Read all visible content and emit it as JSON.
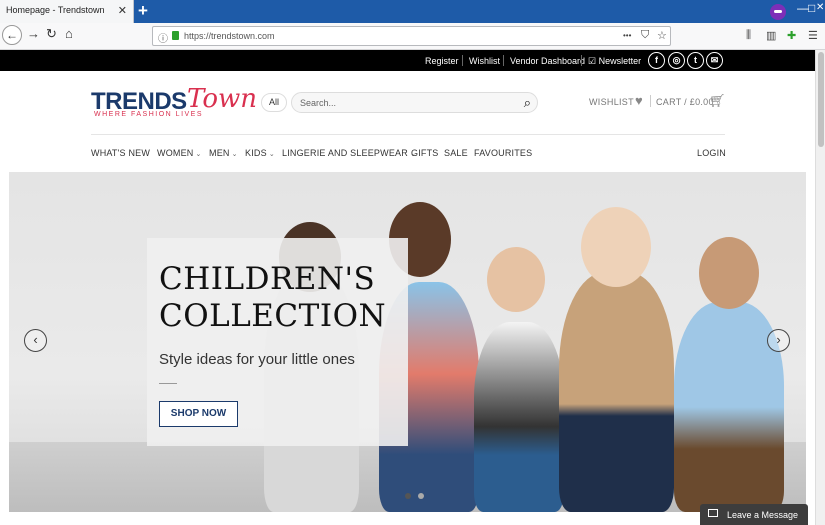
{
  "browser": {
    "tab_title": "Homepage - Trendstown",
    "tab_close": "✕",
    "new_tab": "+",
    "url": "https://trendstown.com",
    "win_min": "—",
    "win_max": "□",
    "win_close": "✕",
    "url_more": "•••"
  },
  "topbar": {
    "links": [
      "Register",
      "Wishlist",
      "Vendor Dashboard",
      "Newsletter"
    ],
    "social": [
      "f",
      "◎",
      "t",
      "✉"
    ]
  },
  "header": {
    "logo_main": "TRENDS",
    "logo_script": "Town",
    "logo_tagline": "WHERE FASHION LIVES",
    "search_category": "All",
    "search_placeholder": "Search...",
    "wishlist_label": "WISHLIST",
    "cart_label": "CART / £0.00"
  },
  "menu": {
    "items": [
      "WHAT'S NEW",
      "WOMEN",
      "MEN",
      "KIDS",
      "LINGERIE AND SLEEPWEAR",
      "GIFTS",
      "SALE",
      "FAVOURITES"
    ],
    "login": "LOGIN"
  },
  "hero": {
    "title": "CHILDREN'S\nCOLLECTION",
    "subtitle": "Style ideas for your little ones",
    "cta": "SHOP NOW",
    "prev": "‹",
    "next": "›"
  },
  "chat": {
    "label": "Leave a Message"
  },
  "colors": {
    "brand_navy": "#1b3a6b",
    "brand_pink": "#d9304f",
    "topbar_bg": "#000000",
    "browser_tab_bar": "#1e5ba8"
  }
}
